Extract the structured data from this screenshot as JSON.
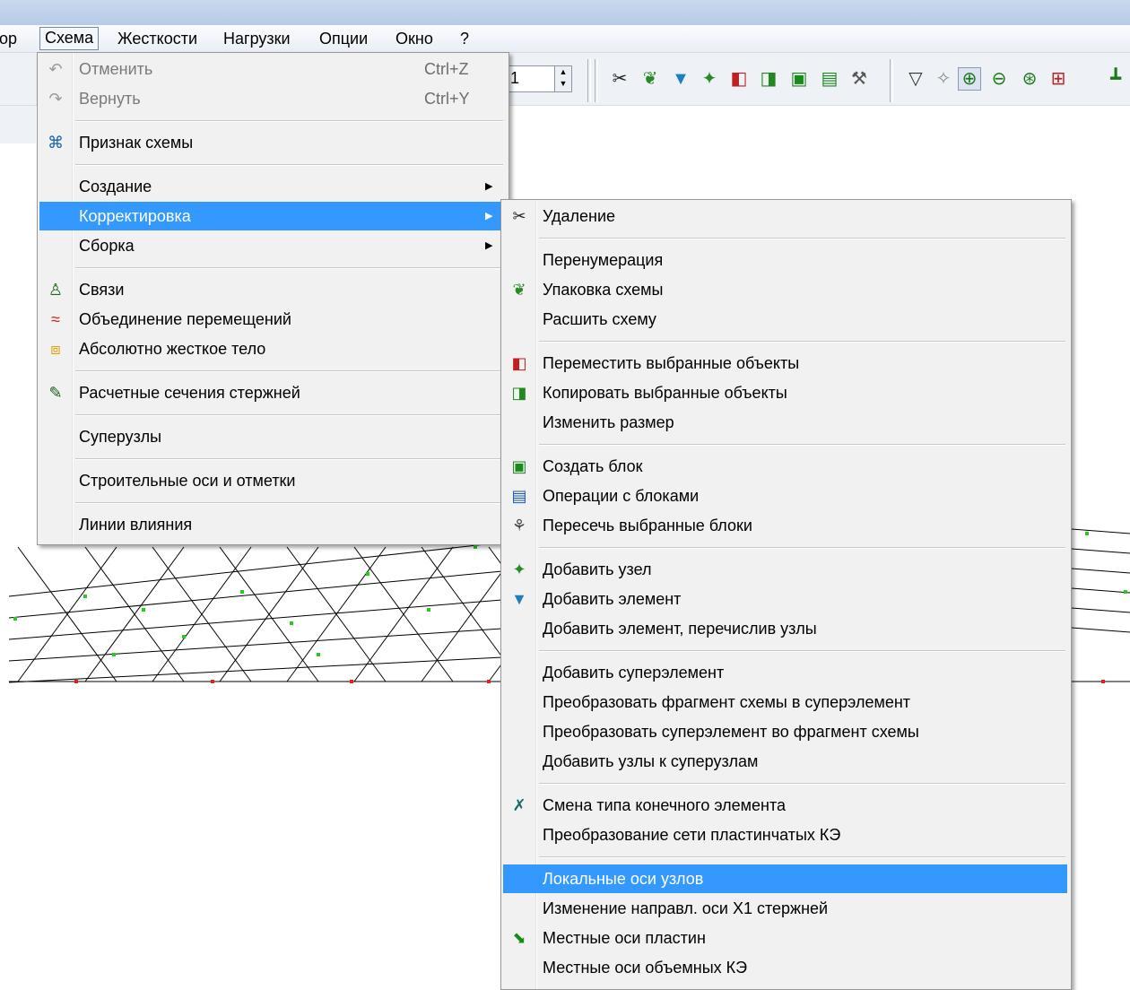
{
  "menubar": [
    "ор",
    "Схема",
    "Жесткости",
    "Нагрузки",
    "Опции",
    "Окно",
    "?"
  ],
  "toolbar": {
    "spin_value": "1",
    "icons": [
      "scissors-icon",
      "pack-icon",
      "add-element-icon",
      "add-node-icon",
      "move-icon",
      "copy-icon",
      "block-icon",
      "wrench-icon",
      "filter-icon",
      "fragment-icon",
      "zoom-in-icon",
      "zoom-out-icon",
      "zoom-all-icon",
      "grid-icon",
      "stick-icon"
    ]
  },
  "schema_menu": [
    {
      "type": "item",
      "label": "Отменить",
      "shortcut": "Ctrl+Z",
      "icon": "undo-icon",
      "disabled": true
    },
    {
      "type": "item",
      "label": "Вернуть",
      "shortcut": "Ctrl+Y",
      "icon": "redo-icon",
      "disabled": true
    },
    {
      "type": "sep"
    },
    {
      "type": "item",
      "label": "Признак схемы",
      "icon": "scheme-sign-icon"
    },
    {
      "type": "sep"
    },
    {
      "type": "item",
      "label": "Создание",
      "submenu": true
    },
    {
      "type": "item",
      "label": "Корректировка",
      "submenu": true,
      "highlighted": true
    },
    {
      "type": "item",
      "label": "Сборка",
      "submenu": true
    },
    {
      "type": "sep"
    },
    {
      "type": "item",
      "label": "Связи",
      "icon": "constraints-icon"
    },
    {
      "type": "item",
      "label": "Объединение перемещений",
      "icon": "join-displacements-icon"
    },
    {
      "type": "item",
      "label": "Абсолютно жесткое тело",
      "icon": "rigid-body-icon"
    },
    {
      "type": "sep"
    },
    {
      "type": "item",
      "label": "Расчетные сечения стержней",
      "icon": "sections-icon"
    },
    {
      "type": "sep"
    },
    {
      "type": "item",
      "label": "Суперузлы"
    },
    {
      "type": "sep"
    },
    {
      "type": "item",
      "label": "Строительные оси и отметки"
    },
    {
      "type": "sep"
    },
    {
      "type": "item",
      "label": "Линии влияния"
    }
  ],
  "correction_menu": [
    {
      "type": "item",
      "label": "Удаление",
      "icon": "scissors-icon"
    },
    {
      "type": "sep"
    },
    {
      "type": "item",
      "label": "Перенумерация"
    },
    {
      "type": "item",
      "label": "Упаковка схемы",
      "icon": "pack-icon"
    },
    {
      "type": "item",
      "label": "Расшить схему"
    },
    {
      "type": "sep"
    },
    {
      "type": "item",
      "label": "Переместить выбранные объекты",
      "icon": "move-icon"
    },
    {
      "type": "item",
      "label": "Копировать выбранные объекты",
      "icon": "copy-icon"
    },
    {
      "type": "item",
      "label": "Изменить размер"
    },
    {
      "type": "sep"
    },
    {
      "type": "item",
      "label": "Создать блок",
      "icon": "block-icon"
    },
    {
      "type": "item",
      "label": "Операции с блоками",
      "icon": "block-ops-icon"
    },
    {
      "type": "item",
      "label": "Пересечь выбранные блоки",
      "icon": "intersect-icon"
    },
    {
      "type": "sep"
    },
    {
      "type": "item",
      "label": "Добавить  узел",
      "icon": "add-node-icon"
    },
    {
      "type": "item",
      "label": "Добавить элемент",
      "icon": "add-element-icon"
    },
    {
      "type": "item",
      "label": "Добавить элемент, перечислив узлы"
    },
    {
      "type": "sep"
    },
    {
      "type": "item",
      "label": "Добавить суперэлемент"
    },
    {
      "type": "item",
      "label": "Преобразовать фрагмент схемы в суперэлемент"
    },
    {
      "type": "item",
      "label": "Преобразовать суперэлемент во фрагмент схемы"
    },
    {
      "type": "item",
      "label": "Добавить узлы к суперузлам"
    },
    {
      "type": "sep"
    },
    {
      "type": "item",
      "label": "Смена типа конечного элемента",
      "icon": "change-type-icon"
    },
    {
      "type": "item",
      "label": "Преобразование сети пластинчатых КЭ"
    },
    {
      "type": "sep"
    },
    {
      "type": "item",
      "label": "Локальные оси узлов",
      "highlighted": true
    },
    {
      "type": "item",
      "label": "Изменение направл. оси X1 стержней"
    },
    {
      "type": "item",
      "label": "Местные оси пластин",
      "icon": "plate-axes-icon"
    },
    {
      "type": "item",
      "label": "Местные оси объемных КЭ"
    }
  ]
}
